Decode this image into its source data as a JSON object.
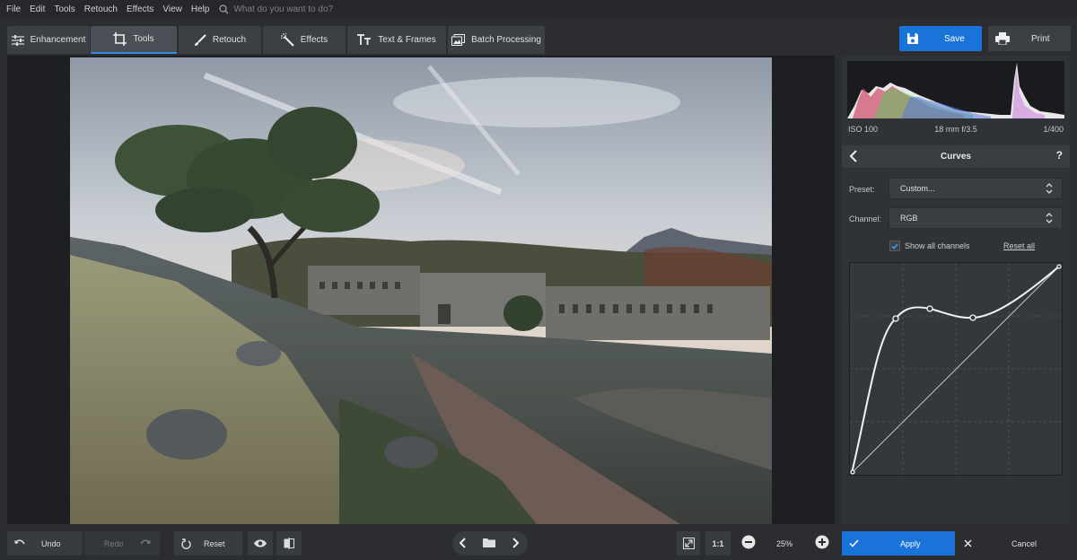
{
  "menu": {
    "items": [
      "File",
      "Edit",
      "Tools",
      "Retouch",
      "Effects",
      "View",
      "Help"
    ],
    "search_placeholder": "What do you want to do?"
  },
  "tabs": {
    "enhancement": "Enhancement",
    "tools": "Tools",
    "retouch": "Retouch",
    "effects": "Effects",
    "text_frames": "Text & Frames",
    "batch": "Batch Processing",
    "active": "Tools"
  },
  "actions": {
    "save": "Save",
    "print": "Print"
  },
  "exif": {
    "iso": "ISO 100",
    "lens": "18 mm f/3.5",
    "shutter": "1/400"
  },
  "curves": {
    "title": "Curves",
    "help": "?",
    "preset_label": "Preset:",
    "preset_value": "Custom...",
    "channel_label": "Channel:",
    "channel_value": "RGB",
    "show_all_channels": "Show all channels",
    "show_all_checked": true,
    "reset_all": "Reset all"
  },
  "bottom": {
    "undo": "Undo",
    "redo": "Redo",
    "reset": "Reset",
    "ratio": "1:1",
    "zoom": "25%",
    "apply": "Apply",
    "cancel": "Cancel"
  },
  "colors": {
    "accent": "#1a73d9",
    "panel": "#2f3236",
    "background": "#2b2d31"
  }
}
